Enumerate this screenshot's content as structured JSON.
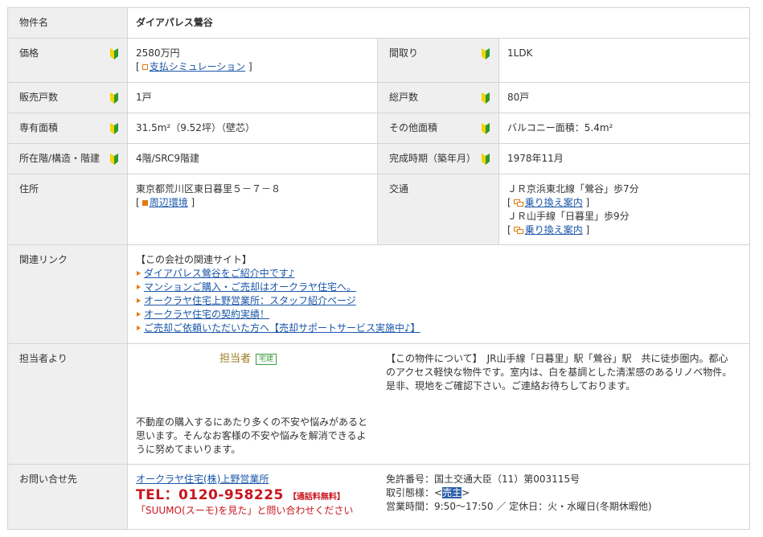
{
  "rows": {
    "name": {
      "label": "物件名",
      "value": "ダイアパレス鶯谷"
    },
    "price": {
      "label": "価格",
      "value": "2580万円",
      "sim_link": "支払シミュレーション"
    },
    "layout": {
      "label": "間取り",
      "value": "1LDK"
    },
    "units_sale": {
      "label": "販売戸数",
      "value": "1戸"
    },
    "units_total": {
      "label": "総戸数",
      "value": "80戸"
    },
    "area": {
      "label": "専有面積",
      "value": "31.5m²（9.52坪）（壁芯）"
    },
    "other_area": {
      "label": "その他面積",
      "value": "バルコニー面積：5.4m²"
    },
    "floor": {
      "label": "所在階/構造・階建",
      "value": "4階/SRC9階建"
    },
    "built": {
      "label": "完成時期（築年月）",
      "value": "1978年11月"
    },
    "address": {
      "label": "住所",
      "value": "東京都荒川区東日暮里５－７－８",
      "env_link": "周辺環境"
    },
    "transport": {
      "label": "交通",
      "lines": [
        {
          "text": "ＪＲ京浜東北線「鶯谷」歩7分",
          "link": "乗り換え案内"
        },
        {
          "text": "ＪＲ山手線「日暮里」歩9分",
          "link": "乗り換え案内"
        }
      ]
    },
    "links": {
      "label": "関連リンク",
      "heading": "【この会社の関連サイト】",
      "items": [
        "ダイアパレス鶯谷をご紹介中です♪",
        "マンションご購入・ご売却はオークラヤ住宅へ。",
        "オークラヤ住宅上野営業所：スタッフ紹介ページ",
        "オークラヤ住宅の契約実績！",
        "ご売却ご依頼いただいた方へ【売却サポートサービス実施中♪】"
      ]
    },
    "staff": {
      "label": "担当者より",
      "title": "担当者",
      "badge": "宅建",
      "message": "不動産の購入するにあたり多くの不安や悩みがあると思います。そんなお客様の不安や悩みを解消できるように努めてまいります。",
      "about": "【この物件について】　JR山手線「日暮里」駅「鶯谷」駅　共に徒歩圏内。都心のアクセス軽快な物件です。室内は、白を基調とした清潔感のあるリノベ物件。是非、現地をご確認下さい。ご連絡お待ちしております。"
    },
    "contact": {
      "label": "お問い合せ先",
      "company": "オークラヤ住宅(株)上野営業所",
      "tel": "TEL：0120-958225",
      "free": "【通話料無料】",
      "note": "「SUUMO(スーモ)を見た」と問い合わせください",
      "license": "免許番号：国土交通大臣（11）第003115号",
      "deal_prefix": "取引態様：<",
      "deal_value": "売主",
      "deal_suffix": ">",
      "hours": "営業時間：9:50～17:50 ／ 定休日：火・水曜日(冬期休暇他)"
    }
  },
  "brackets": {
    "open": "[",
    "close": "]"
  },
  "icons": {
    "beginner": "beginner-mark-icon",
    "calc": "square-icon",
    "map": "map-square-icon",
    "transfer": "transfer-icon"
  },
  "colors": {
    "label_bg": "#efefef",
    "border": "#d4d4d4",
    "link": "#1a56a8",
    "tel_red": "#c8161d",
    "accent_orange": "#e07a10"
  }
}
